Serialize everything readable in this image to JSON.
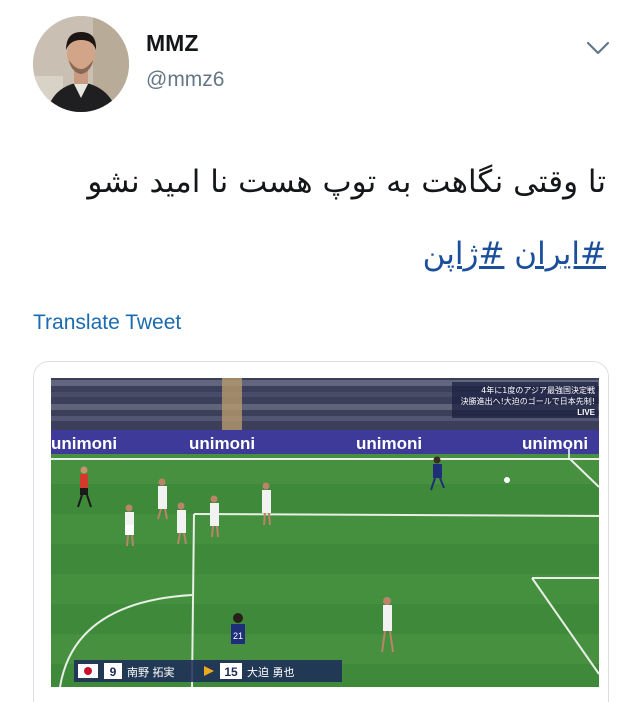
{
  "tweet": {
    "author_name": "MMZ",
    "author_handle": "@mmz6",
    "text": "تا وقتی نگاهت به توپ هست نا امید نشو",
    "hashtags": [
      "#ایران",
      "#ژاپن"
    ],
    "translate_label": "Translate Tweet"
  },
  "media": {
    "ad_board_text": "unimoni",
    "broadcast_graphic": {
      "line1": "4年に1度のアジア最強国決定戦",
      "line2": "決勝進出へ!大迫のゴールで日本先制!",
      "live": "LIVE"
    },
    "player_caption": {
      "player1_number": "9",
      "player1_name": "南野 拓実",
      "player2_number": "15",
      "player2_name": "大迫 勇也"
    },
    "shirt_number_visible": "21"
  },
  "colors": {
    "handle_gray": "#657786",
    "link_blue": "#1b6bb0",
    "hashtag_blue": "#1b4f9c",
    "pitch_green": "#3f8a3a"
  },
  "icons": {
    "menu": "chevron-down-icon"
  }
}
